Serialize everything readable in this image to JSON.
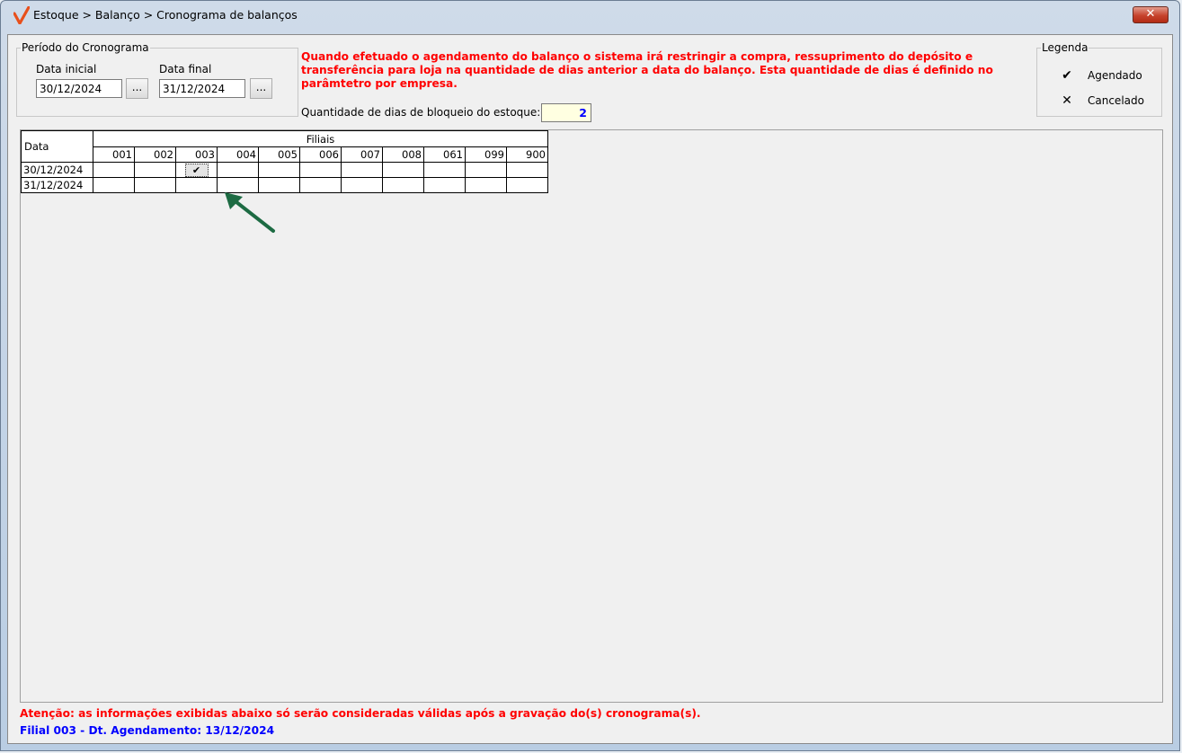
{
  "window": {
    "title": "Estoque > Balanço > Cronograma de balanços",
    "close_label": "✕"
  },
  "period": {
    "legend": "Período do Cronograma",
    "start_label": "Data inicial",
    "start_value": "30/12/2024",
    "end_label": "Data final",
    "end_value": "31/12/2024",
    "picker_label": "..."
  },
  "warning": "Quando efetuado o agendamento do balanço o sistema irá restringir a compra, ressuprimento do depósito e transferência para loja na quantidade de dias anterior a data do balanço. Esta quantidade de dias é definido no parâmtetro por empresa.",
  "block_days": {
    "label": "Quantidade de dias de bloqueio do estoque:",
    "value": "2"
  },
  "legend": {
    "title": "Legenda",
    "scheduled_symbol": "✔",
    "scheduled_label": "Agendado",
    "cancelled_symbol": "✕",
    "cancelled_label": "Cancelado"
  },
  "grid": {
    "date_header": "Data",
    "filiais_header": "Filiais",
    "branches": [
      "001",
      "002",
      "003",
      "004",
      "005",
      "006",
      "007",
      "008",
      "061",
      "099",
      "900"
    ],
    "rows": [
      {
        "date": "30/12/2024",
        "marks": [
          "",
          "",
          "✔",
          "",
          "",
          "",
          "",
          "",
          "",
          "",
          ""
        ]
      },
      {
        "date": "31/12/2024",
        "marks": [
          "",
          "",
          "",
          "",
          "",
          "",
          "",
          "",
          "",
          "",
          ""
        ]
      }
    ]
  },
  "footer": {
    "warning": "Atenção: as informações exibidas abaixo só serão consideradas válidas após a gravação do(s) cronograma(s).",
    "info": "Filial 003 - Dt. Agendamento: 13/12/2024"
  },
  "colors": {
    "warning": "#ff0000",
    "info": "#0000ff",
    "arrow": "#1d6b43"
  }
}
